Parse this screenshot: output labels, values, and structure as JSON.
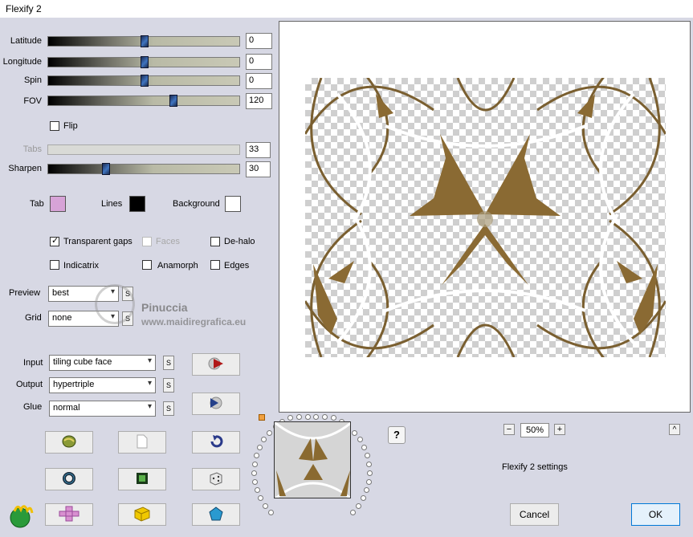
{
  "window": {
    "title": "Flexify 2"
  },
  "sliders": [
    {
      "label": "Latitude",
      "value": "0",
      "pos": 0.5
    },
    {
      "label": "Longitude",
      "value": "0",
      "pos": 0.5
    },
    {
      "label": "Spin",
      "value": "0",
      "pos": 0.5
    },
    {
      "label": "FOV",
      "value": "120",
      "pos": 0.65
    }
  ],
  "flip": {
    "label": "Flip",
    "checked": false
  },
  "tabs": {
    "label": "Tabs",
    "value": "33"
  },
  "sharpen": {
    "label": "Sharpen",
    "value": "30",
    "pos": 0.3
  },
  "colors": {
    "tab_label": "Tab",
    "tab_color": "#d7a3d7",
    "lines_label": "Lines",
    "lines_color": "#000000",
    "background_label": "Background",
    "background_color": "#ffffff"
  },
  "options": {
    "transparent_gaps": "Transparent gaps",
    "faces": "Faces",
    "de_halo": "De-halo",
    "indicatrix": "Indicatrix",
    "anamorph": "Anamorph",
    "edges": "Edges"
  },
  "preview": {
    "label": "Preview",
    "value": "best"
  },
  "grid": {
    "label": "Grid",
    "value": "none"
  },
  "watermark": {
    "name": "Pinuccia",
    "site": "www.maidiregrafica.eu"
  },
  "input": {
    "label": "Input",
    "value": "tiling cube face"
  },
  "output": {
    "label": "Output",
    "value": "hypertriple"
  },
  "glue": {
    "label": "Glue",
    "value": "normal"
  },
  "s_label": "S",
  "zoom": {
    "minus": "−",
    "value": "50%",
    "plus": "+",
    "up": "^"
  },
  "help": "?",
  "settings_label": "Flexify 2 settings",
  "buttons": {
    "cancel": "Cancel",
    "ok": "OK"
  },
  "accent": "#0078d7"
}
